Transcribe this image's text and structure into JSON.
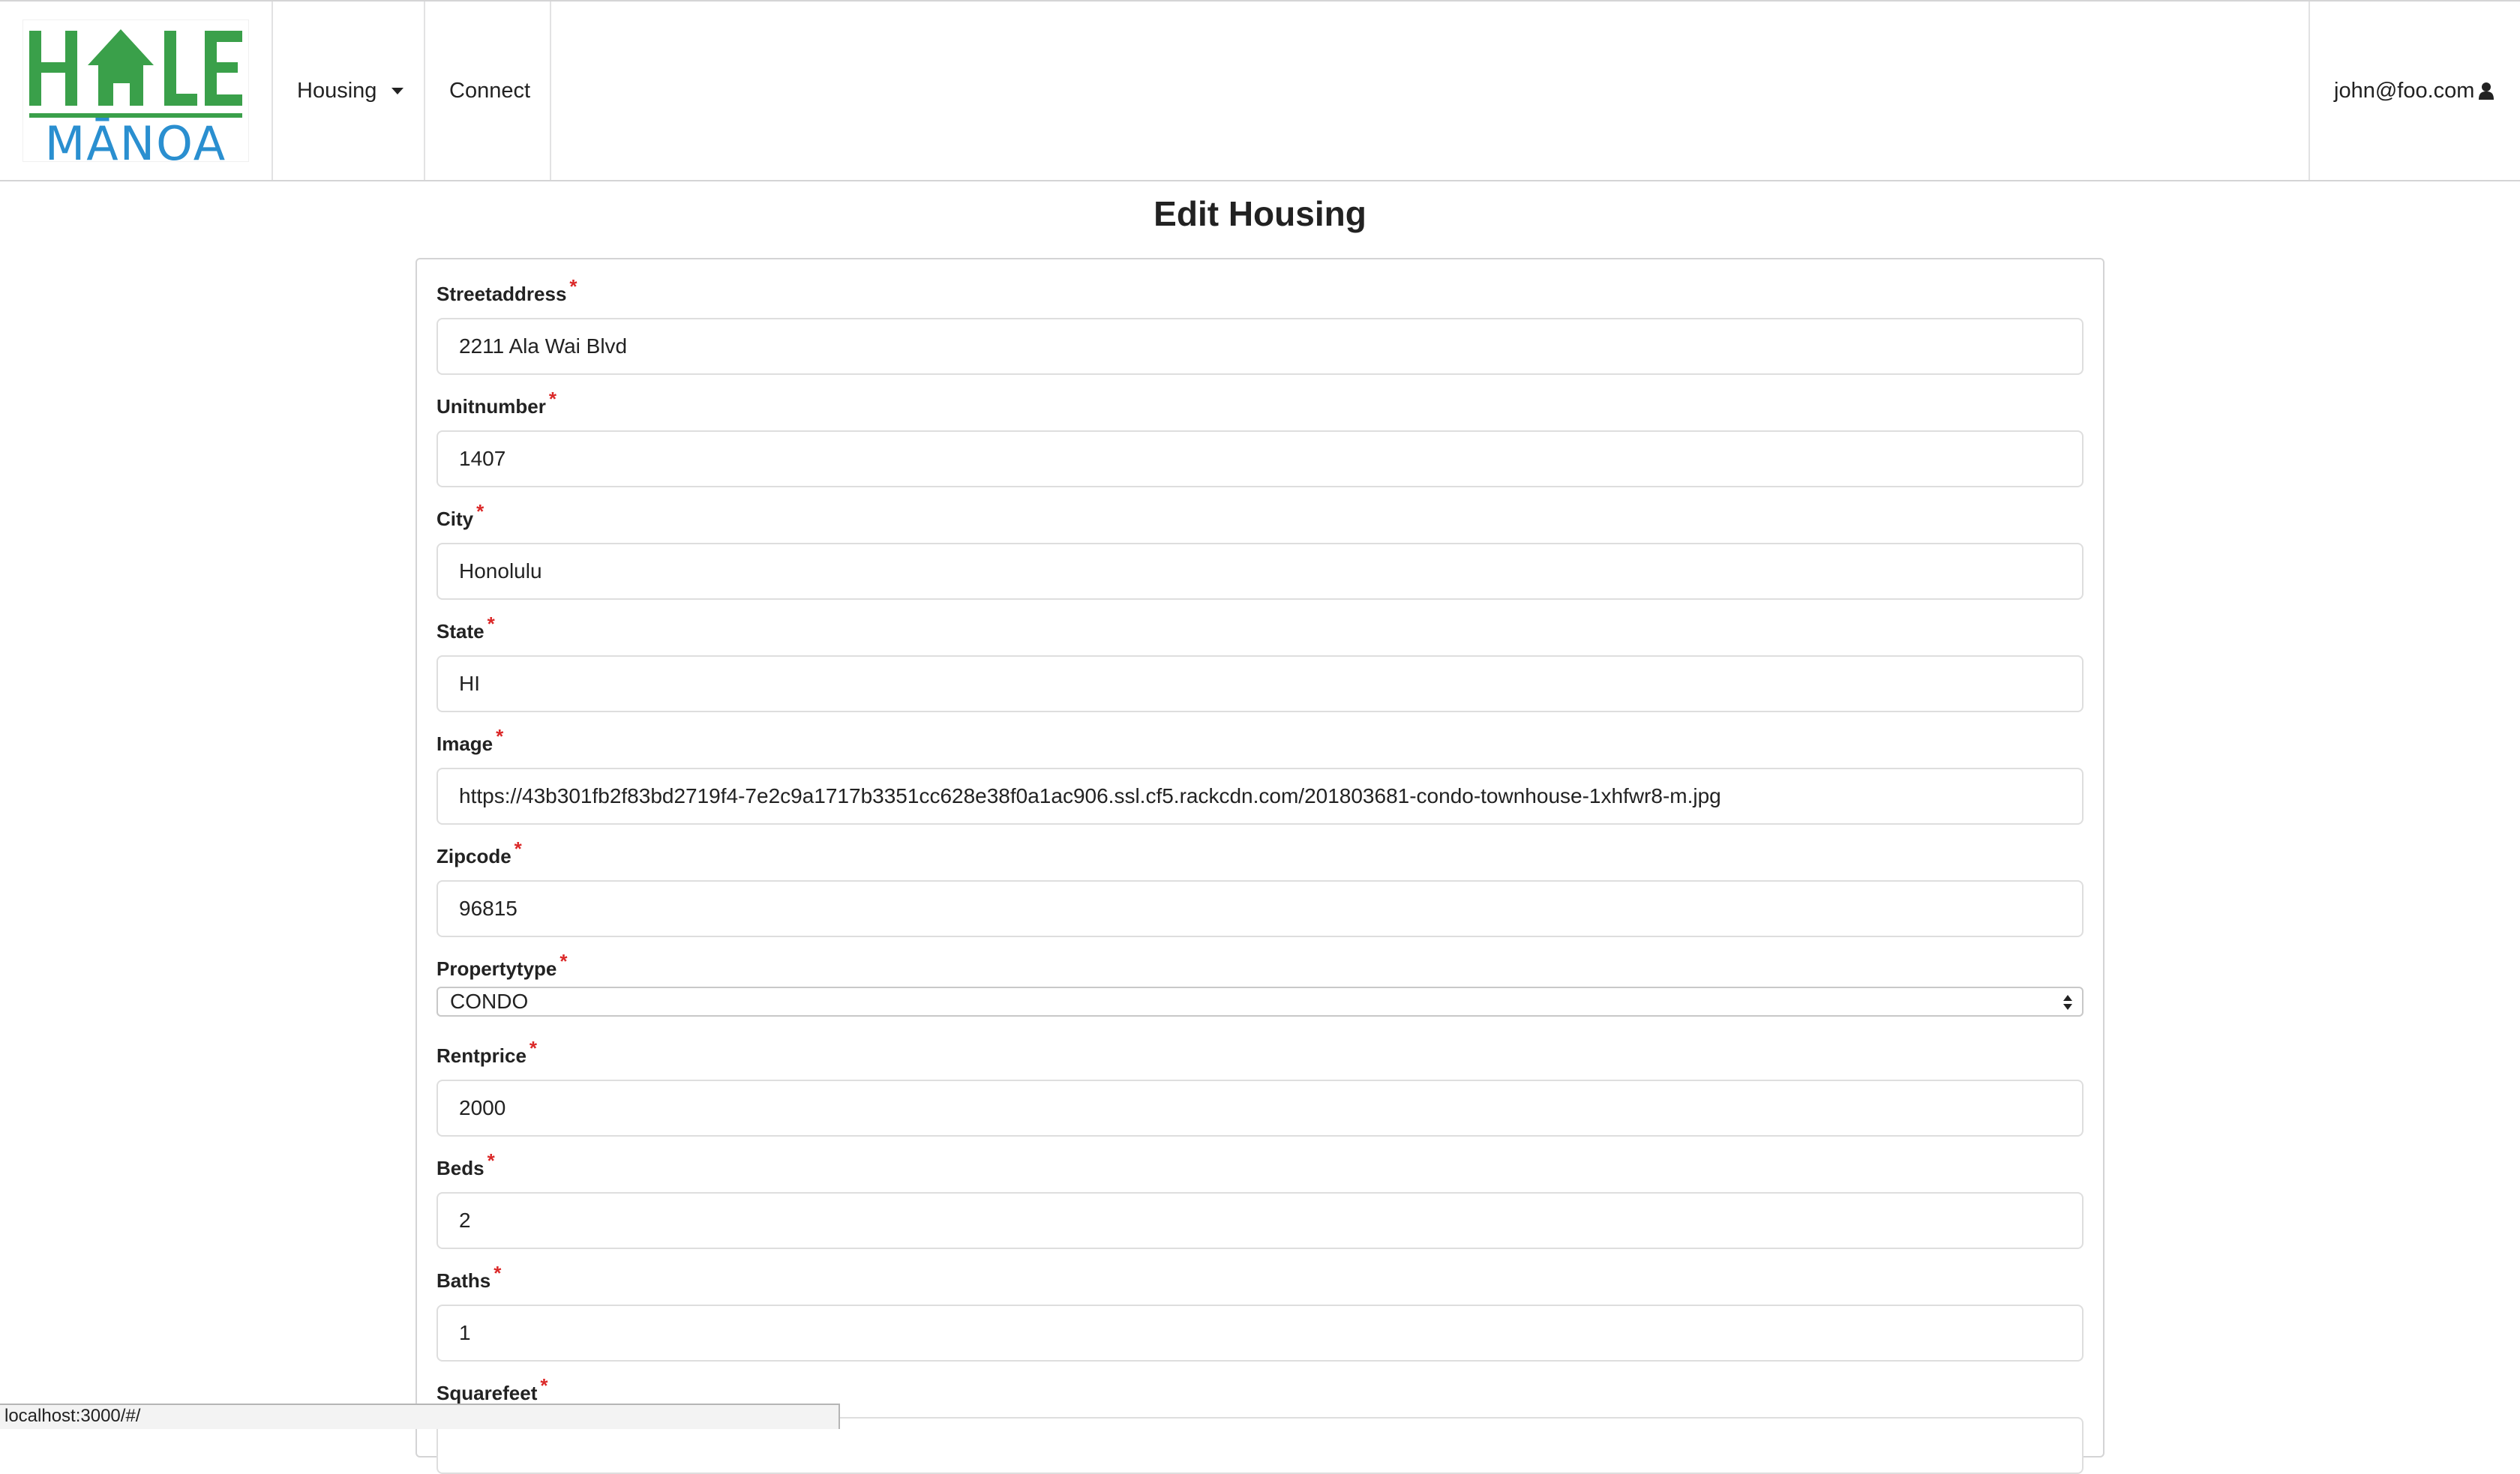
{
  "brand": {
    "logo_top": "HALE",
    "logo_bottom": "MĀNOA",
    "colors": {
      "green": "#3aa04a",
      "blue": "#2a8fd0"
    }
  },
  "nav": {
    "housing_label": "Housing",
    "connect_label": "Connect",
    "user_label": "john@foo.com",
    "user_icon": "user-icon",
    "caret_icon": "caret-down-icon"
  },
  "page": {
    "title": "Edit Housing"
  },
  "form": {
    "required_marker": "*",
    "required_color": "#db2828",
    "fields": [
      {
        "label": "Streetaddress",
        "value": "2211 Ala Wai Blvd"
      },
      {
        "label": "Unitnumber",
        "value": "1407"
      },
      {
        "label": "City",
        "value": "Honolulu"
      },
      {
        "label": "State",
        "value": "HI"
      },
      {
        "label": "Image",
        "value": "https://43b301fb2f83bd2719f4-7e2c9a1717b3351cc628e38f0a1ac906.ssl.cf5.rackcdn.com/201803681-condo-townhouse-1xhfwr8-m.jpg"
      },
      {
        "label": "Zipcode",
        "value": "96815"
      },
      {
        "label": "Propertytype",
        "value": "CONDO"
      },
      {
        "label": "Rentprice",
        "value": "2000"
      },
      {
        "label": "Beds",
        "value": "2"
      },
      {
        "label": "Baths",
        "value": "1"
      },
      {
        "label": "Squarefeet",
        "value": ""
      }
    ]
  },
  "status_bar": {
    "url": "localhost:3000/#/"
  }
}
